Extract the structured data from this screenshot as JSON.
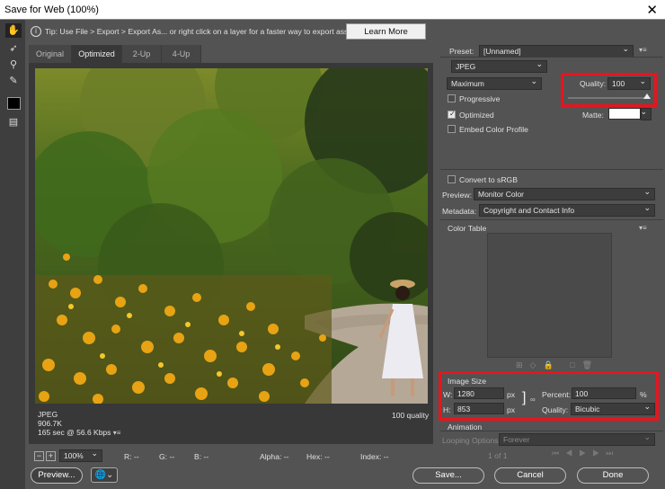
{
  "window": {
    "title": "Save for Web (100%)"
  },
  "tip": {
    "text": "Tip: Use File > Export > Export As...  or right click on a layer for a faster way to export assets",
    "learn_more": "Learn More"
  },
  "tabs": [
    {
      "label": "Original"
    },
    {
      "label": "Optimized"
    },
    {
      "label": "2-Up"
    },
    {
      "label": "4-Up"
    }
  ],
  "image_info": {
    "format": "JPEG",
    "size": "906.7K",
    "time": "165 sec @ 56.6 Kbps",
    "quality_note": "100 quality"
  },
  "status": {
    "zoom": "100%",
    "r": "R: --",
    "g": "G: --",
    "b": "B: --",
    "alpha": "Alpha: --",
    "hex": "Hex: --",
    "index": "Index: --"
  },
  "settings": {
    "preset_label": "Preset:",
    "preset_value": "[Unnamed]",
    "format": "JPEG",
    "compression": "Maximum",
    "quality_label": "Quality:",
    "quality_value": "100",
    "progressive": "Progressive",
    "optimized": "Optimized",
    "embed_profile": "Embed Color Profile",
    "matte_label": "Matte:",
    "convert_srgb": "Convert to sRGB",
    "preview_label": "Preview:",
    "preview_value": "Monitor Color",
    "metadata_label": "Metadata:",
    "metadata_value": "Copyright and Contact Info"
  },
  "color_table": {
    "title": "Color Table"
  },
  "image_size": {
    "title": "Image Size",
    "w_label": "W:",
    "w_value": "1280",
    "h_label": "H:",
    "h_value": "853",
    "px": "px",
    "percent_label": "Percent:",
    "percent_value": "100",
    "percent_unit": "%",
    "quality_label": "Quality:",
    "quality_value": "Bicubic"
  },
  "animation": {
    "title": "Animation",
    "looping_label": "Looping Options:",
    "looping_value": "Forever",
    "frame": "1 of 1"
  },
  "buttons": {
    "preview": "Preview...",
    "save": "Save...",
    "cancel": "Cancel",
    "done": "Done"
  }
}
